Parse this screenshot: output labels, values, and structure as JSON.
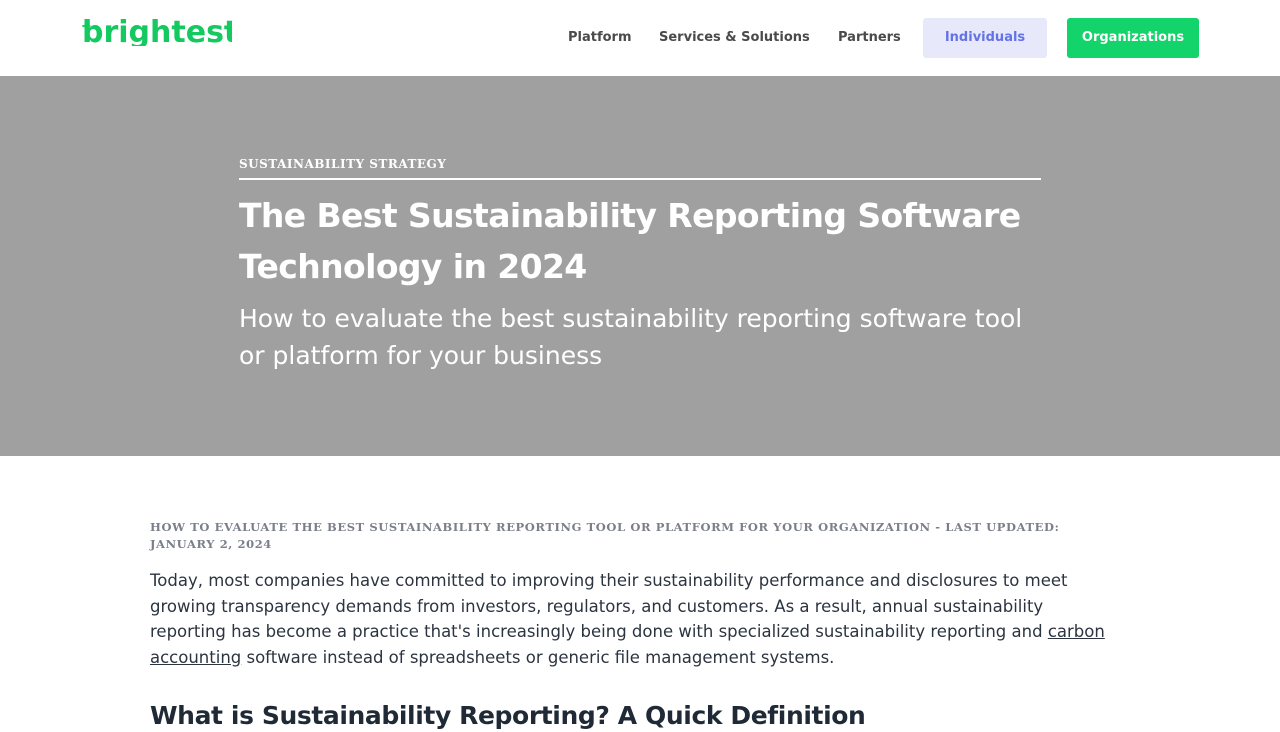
{
  "header": {
    "logo_text": "brightest",
    "nav": {
      "platform": "Platform",
      "services": "Services & Solutions",
      "partners": "Partners"
    },
    "buttons": {
      "individuals": "Individuals",
      "organizations": "Organizations"
    }
  },
  "hero": {
    "eyebrow": "SUSTAINABILITY STRATEGY",
    "title": "The Best Sustainability Reporting Software Technology in 2024",
    "subtitle": "How to evaluate the best sustainability reporting software tool or platform for your business"
  },
  "article": {
    "meta": "HOW TO EVALUATE THE BEST SUSTAINABILITY REPORTING TOOL OR PLATFORM FOR YOUR ORGANIZATION - LAST UPDATED: JANUARY 2, 2024",
    "intro_before_link": "Today, most companies have committed to improving their sustainability performance and disclosures to meet growing transparency demands from investors, regulators, and customers. As a result, annual sustainability reporting has become a practice that's increasingly being done with specialized sustainability reporting and ",
    "intro_link": "carbon accounting",
    "intro_after_link": " software instead of spreadsheets or generic file management systems.",
    "section_heading": "What is Sustainability Reporting? A Quick Definition"
  },
  "colors": {
    "brand_green": "#13d46a",
    "individuals_bg": "#e7e9fb",
    "individuals_text": "#6572e6",
    "hero_bg": "#a0a0a0",
    "body_text": "#2c3440"
  },
  "icons": {
    "logo_spark": "spark-icon"
  }
}
